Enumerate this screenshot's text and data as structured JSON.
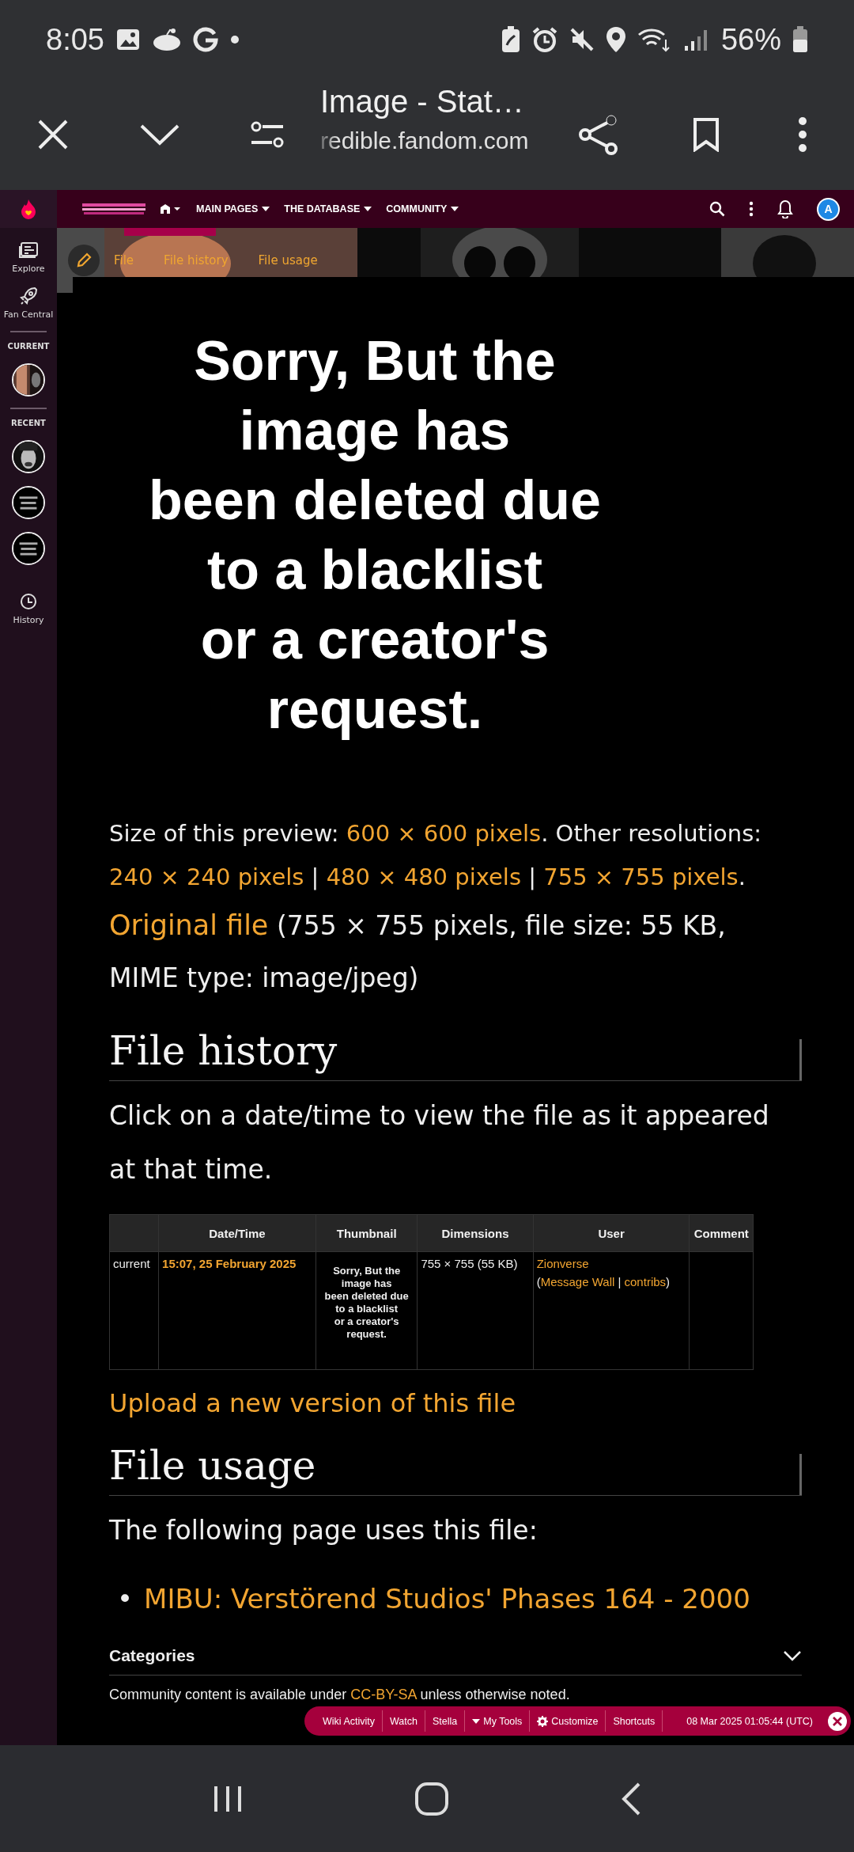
{
  "status_bar": {
    "time": "8:05",
    "battery": "56%"
  },
  "browser_bar": {
    "title": "Image - Stat…",
    "url": "redible.fandom.com"
  },
  "sidebar": {
    "items": [
      {
        "kind": "link",
        "label": "Explore"
      },
      {
        "kind": "link",
        "label": "Fan Central"
      },
      {
        "kind": "section",
        "label": "CURRENT"
      },
      {
        "kind": "thumb"
      },
      {
        "kind": "section",
        "label": "RECENT"
      },
      {
        "kind": "thumb"
      },
      {
        "kind": "thumb"
      },
      {
        "kind": "thumb"
      },
      {
        "kind": "link",
        "label": "History"
      }
    ]
  },
  "wiki_nav": {
    "menus": [
      "MAIN PAGES",
      "THE DATABASE",
      "COMMUNITY"
    ],
    "avatar": "A"
  },
  "page_tabs": [
    "File",
    "File history",
    "File usage"
  ],
  "preview": {
    "lines": [
      "Sorry, But the",
      "image has",
      "been deleted due",
      "to a blacklist",
      "or a creator's",
      "request."
    ]
  },
  "file_info": [
    [
      {
        "text": "Size of this preview: ",
        "link": false
      },
      {
        "text": "600 × 600 pixels",
        "link": true
      },
      {
        "text": ". Other resolutions: ",
        "link": false
      },
      {
        "text": "240 × 240 pixels",
        "link": true
      },
      {
        "text": " | ",
        "link": false
      },
      {
        "text": "480 × 480 pixels",
        "link": true
      },
      {
        "text": " | ",
        "link": false
      },
      {
        "text": "755 × 755 pixels",
        "link": true
      },
      {
        "text": ".",
        "link": false
      }
    ],
    [
      {
        "text": "Original file",
        "link": true
      },
      {
        "text": " (755 × 755 pixels, file size: 55 KB, MIME type: image/jpeg)",
        "link": false
      }
    ]
  ],
  "file_history": {
    "heading": "File history",
    "intro": "Click on a date/time to view the file as it appeared at that time.",
    "columns": [
      "Date/Time",
      "Thumbnail",
      "Dimensions",
      "User",
      "Comment"
    ],
    "rows": [
      {
        "version": "current",
        "datetime": "15:07, 25 February 2025",
        "thumbnail_lines": [
          "Sorry, But the",
          "image has",
          "been deleted due",
          "to a blacklist",
          "or a creator's",
          "request."
        ],
        "dimensions": "755 × 755 (55 KB)",
        "user": "Zionverse",
        "user_tools": [
          {
            "text": "(",
            "link": false
          },
          {
            "text": "Message Wall",
            "link": true
          },
          {
            "text": " | ",
            "link": false
          },
          {
            "text": "contribs",
            "link": true
          },
          {
            "text": ")",
            "link": false
          }
        ]
      }
    ]
  },
  "upload_link": "Upload a new version of this file",
  "file_usage": {
    "heading": "File usage",
    "intro": "The following page uses this file:",
    "pages": [
      {
        "bullet": "•",
        "title": "MIBU: Verstörend Studios' Phases 164 - 2000"
      }
    ]
  },
  "categories": {
    "label": "Categories",
    "expanded": false
  },
  "footer": [
    {
      "text": "Community content is available under ",
      "link": false
    },
    {
      "text": "CC-BY-SA",
      "link": true
    },
    {
      "text": " unless otherwise noted.",
      "link": false
    }
  ],
  "toolbar": {
    "items": [
      {
        "label": "Wiki Activity"
      },
      {
        "label": "Watch"
      },
      {
        "label": "Stella"
      },
      {
        "label": "My Tools"
      },
      {
        "label": "Customize"
      },
      {
        "label": "Shortcuts"
      }
    ],
    "timestamp": "08 Mar 2025 01:05:44 (UTC)"
  }
}
